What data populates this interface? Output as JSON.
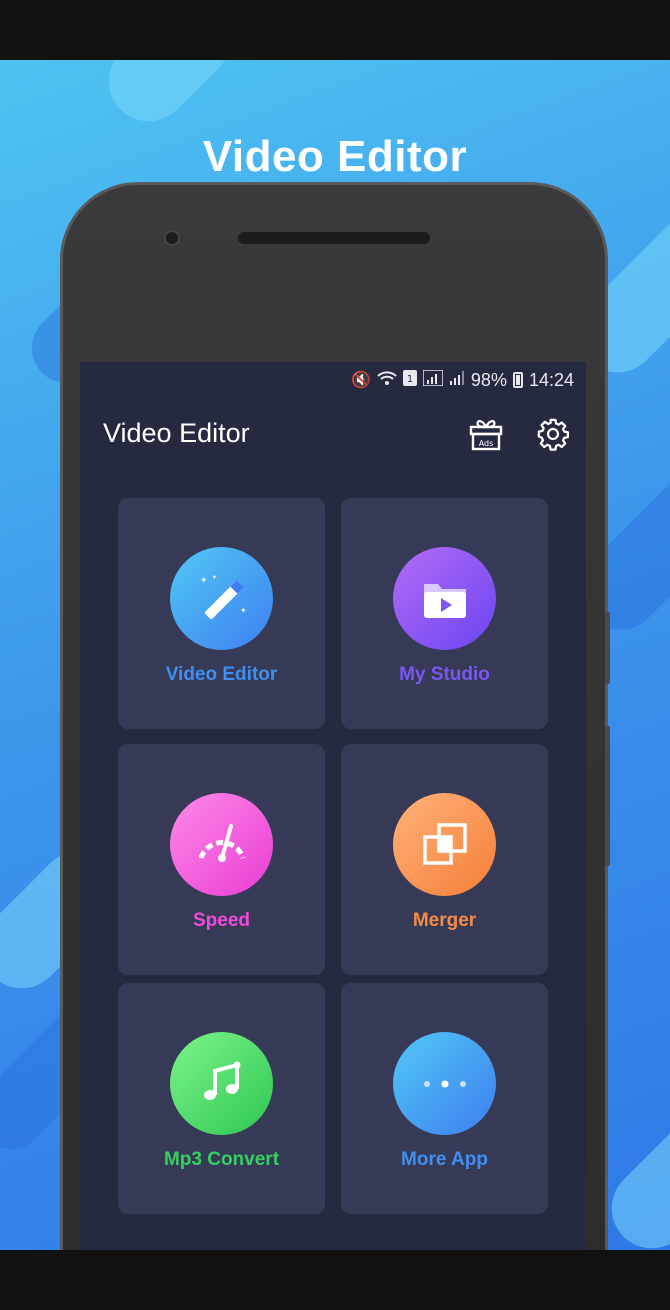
{
  "promo": {
    "title": "Video Editor"
  },
  "status_bar": {
    "battery": "98%",
    "time": "14:24"
  },
  "app": {
    "title": "Video Editor",
    "ads_badge": "Ads"
  },
  "tiles": [
    {
      "label": "Video Editor",
      "icon": "magic-wand-icon",
      "color": "#3f8ef0"
    },
    {
      "label": "My Studio",
      "icon": "folder-play-icon",
      "color": "#7a57f4"
    },
    {
      "label": "Speed",
      "icon": "speedometer-icon",
      "color": "#f04ad8"
    },
    {
      "label": "Merger",
      "icon": "merge-squares-icon",
      "color": "#f58b45"
    },
    {
      "label": "Mp3 Convert",
      "icon": "music-note-icon",
      "color": "#35d060"
    },
    {
      "label": "More App",
      "icon": "more-dots-icon",
      "color": "#3f8ef0"
    }
  ]
}
